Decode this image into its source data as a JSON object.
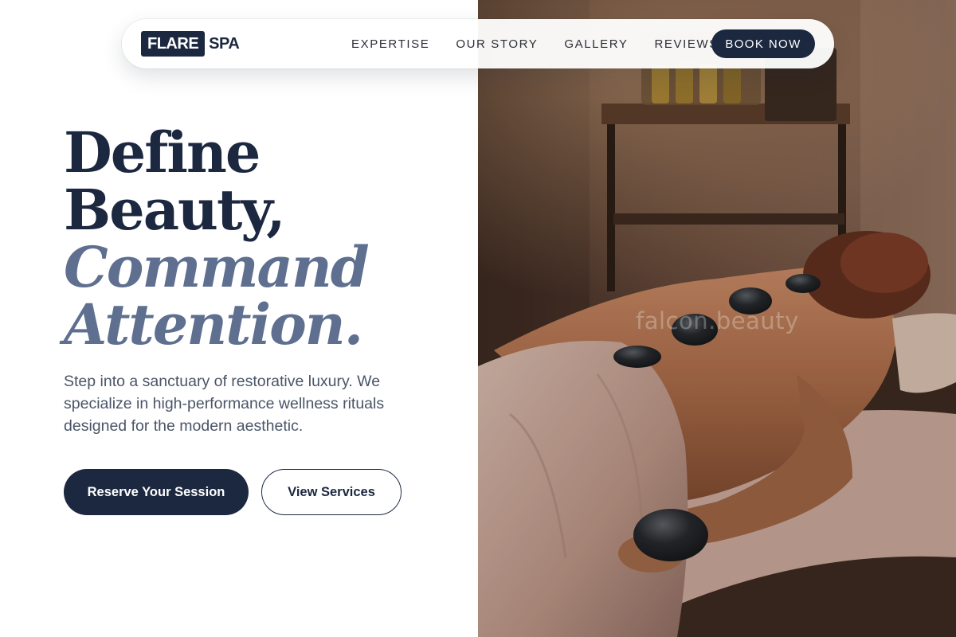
{
  "brand": {
    "logo_box": "FLARE",
    "logo_text": "SPA"
  },
  "nav": {
    "links": [
      {
        "label": "EXPERTISE"
      },
      {
        "label": "OUR STORY"
      },
      {
        "label": "GALLERY"
      },
      {
        "label": "REVIEWS"
      }
    ],
    "cta": "BOOK NOW"
  },
  "hero": {
    "headline": {
      "line1": "Define",
      "line2": "Beauty,",
      "line3": "Command",
      "line4": "Attention."
    },
    "lead": "Step into a sanctuary of restorative luxury. We specialize in high-performance wellness rituals designed for the modern aesthetic.",
    "primary_cta": "Reserve Your Session",
    "secondary_cta": "View Services"
  },
  "image": {
    "watermark": "falcon.beauty"
  },
  "colors": {
    "navy": "#1c2840",
    "slate": "#5f6f8f",
    "body_text": "#4a5568"
  }
}
